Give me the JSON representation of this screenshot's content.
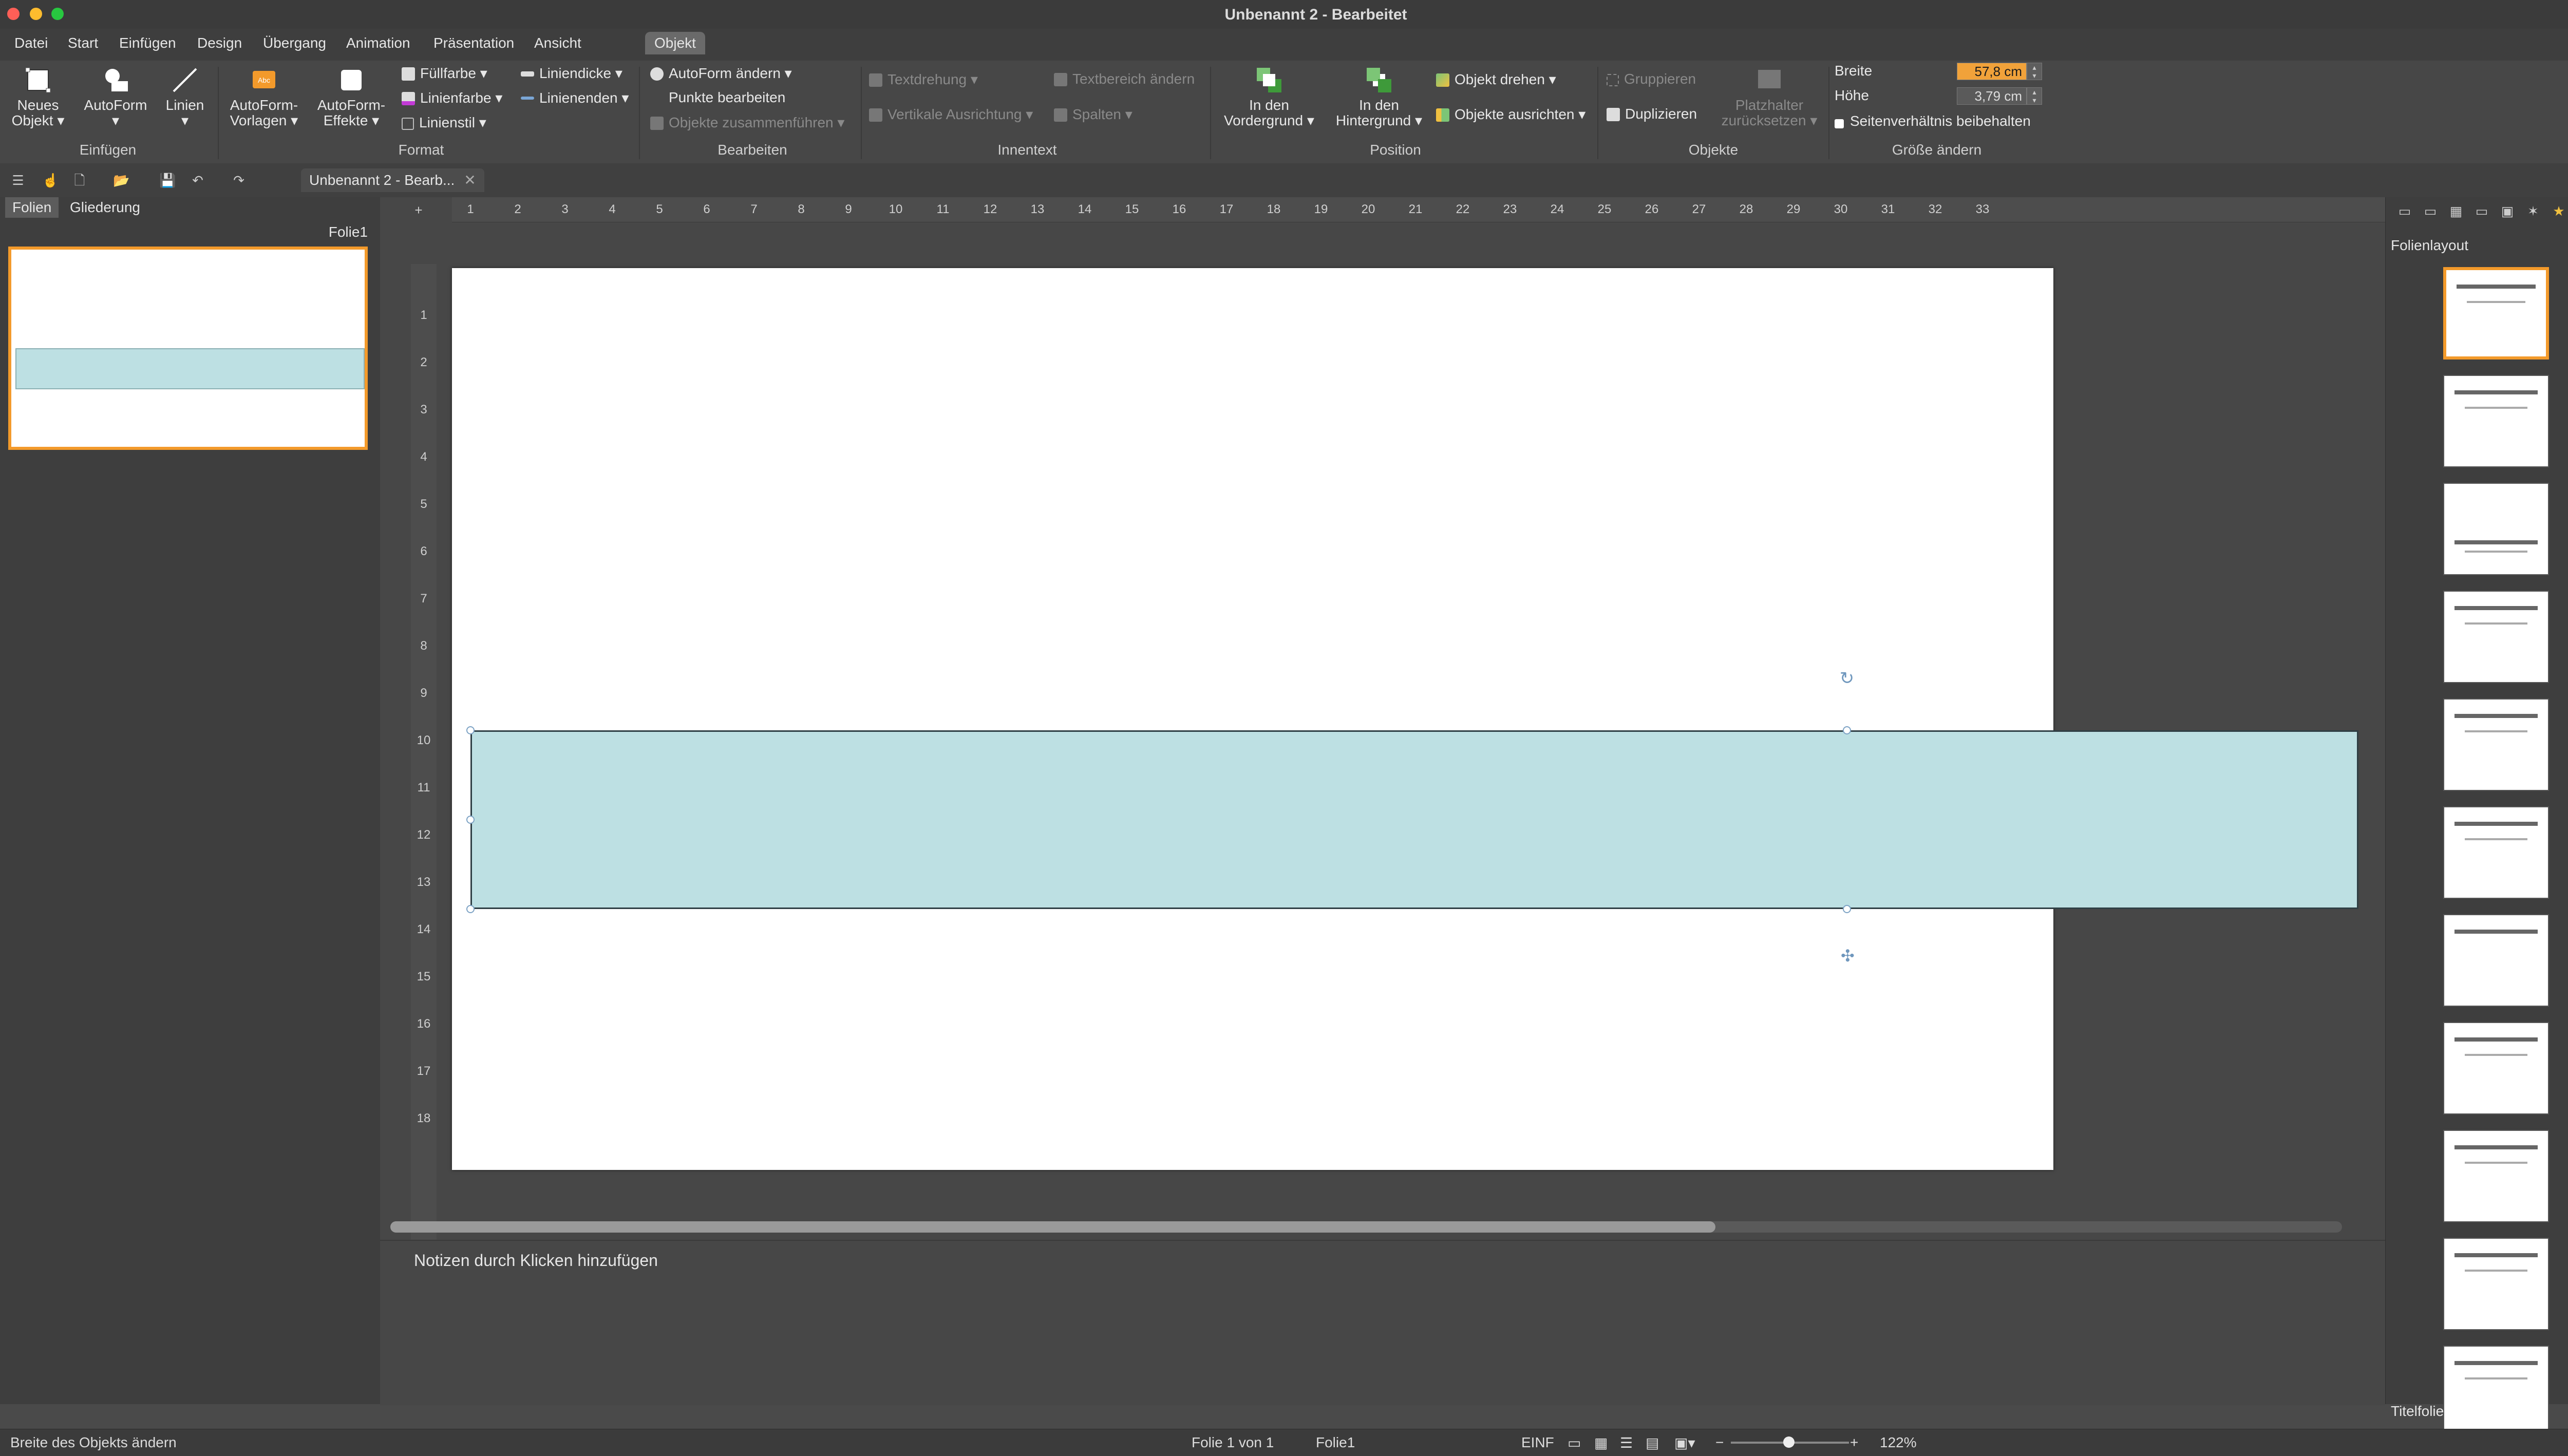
{
  "window": {
    "title": "Unbenannt 2 - Bearbeitet"
  },
  "menu": {
    "tabs": [
      "Datei",
      "Start",
      "Einfügen",
      "Design",
      "Übergang",
      "Animation",
      "Präsentation",
      "Ansicht",
      "Objekt"
    ],
    "active": "Objekt",
    "help": "?"
  },
  "ribbon": {
    "einfuegen": {
      "neues_objekt": "Neues Objekt",
      "autoform": "AutoForm",
      "linien": "Linien",
      "label": "Einfügen"
    },
    "format": {
      "vorlagen": "AutoForm-Vorlagen",
      "effekte": "AutoForm-Effekte",
      "fuellfarbe": "Füllfarbe",
      "linienfarbe": "Linienfarbe",
      "linienstil": "Linienstil",
      "liniendicke": "Liniendicke",
      "linienenden": "Linienenden",
      "label": "Format"
    },
    "bearbeiten": {
      "autoform_aendern": "AutoForm ändern",
      "punkte": "Punkte bearbeiten",
      "zusammenfuehren": "Objekte zusammenführen",
      "label": "Bearbeiten"
    },
    "innentext": {
      "textdrehung": "Textdrehung",
      "textbereich": "Textbereich ändern",
      "vertikal": "Vertikale Ausrichtung",
      "spalten": "Spalten",
      "label": "Innentext"
    },
    "position": {
      "vordergrund": "In den Vordergrund",
      "hintergrund": "In den Hintergrund",
      "drehen": "Objekt drehen",
      "ausrichten": "Objekte ausrichten",
      "label": "Position"
    },
    "objekte": {
      "gruppieren": "Gruppieren",
      "duplizieren": "Duplizieren",
      "platzhalter": "Platzhalter zurücksetzen",
      "label": "Objekte"
    },
    "groesse": {
      "breite_label": "Breite",
      "breite": "57,8 cm",
      "hoehe_label": "Höhe",
      "hoehe": "3,79 cm",
      "seitenverhaeltnis": "Seitenverhältnis beibehalten",
      "label": "Größe ändern"
    }
  },
  "toolbar": {
    "doc_tab": "Unbenannt 2 - Bearb..."
  },
  "slides_panel": {
    "tab_folien": "Folien",
    "tab_gliederung": "Gliederung",
    "slide_name": "Folie1"
  },
  "ruler": {
    "h": [
      "1",
      "2",
      "3",
      "4",
      "5",
      "6",
      "7",
      "8",
      "9",
      "10",
      "11",
      "12",
      "13",
      "14",
      "15",
      "16",
      "17",
      "18",
      "19",
      "20",
      "21",
      "22",
      "23",
      "24",
      "25",
      "26",
      "27",
      "28",
      "29",
      "30",
      "31",
      "32",
      "33"
    ],
    "v": [
      "1",
      "2",
      "3",
      "4",
      "5",
      "6",
      "7",
      "8",
      "9",
      "10",
      "11",
      "12",
      "13",
      "14",
      "15",
      "16",
      "17",
      "18"
    ]
  },
  "notes": {
    "placeholder": "Notizen durch Klicken hinzufügen"
  },
  "layout_panel": {
    "title": "Folienlayout",
    "footer": "Titelfolie",
    "count": 11
  },
  "status": {
    "hint": "Breite des Objekts ändern",
    "slide_of": "Folie 1 von 1",
    "slide_name": "Folie1",
    "mode": "EINF",
    "zoom": "122%"
  },
  "colors": {
    "accent": "#f39a2b",
    "shape_fill": "#bde0e3",
    "handle": "#7ca2c4"
  }
}
